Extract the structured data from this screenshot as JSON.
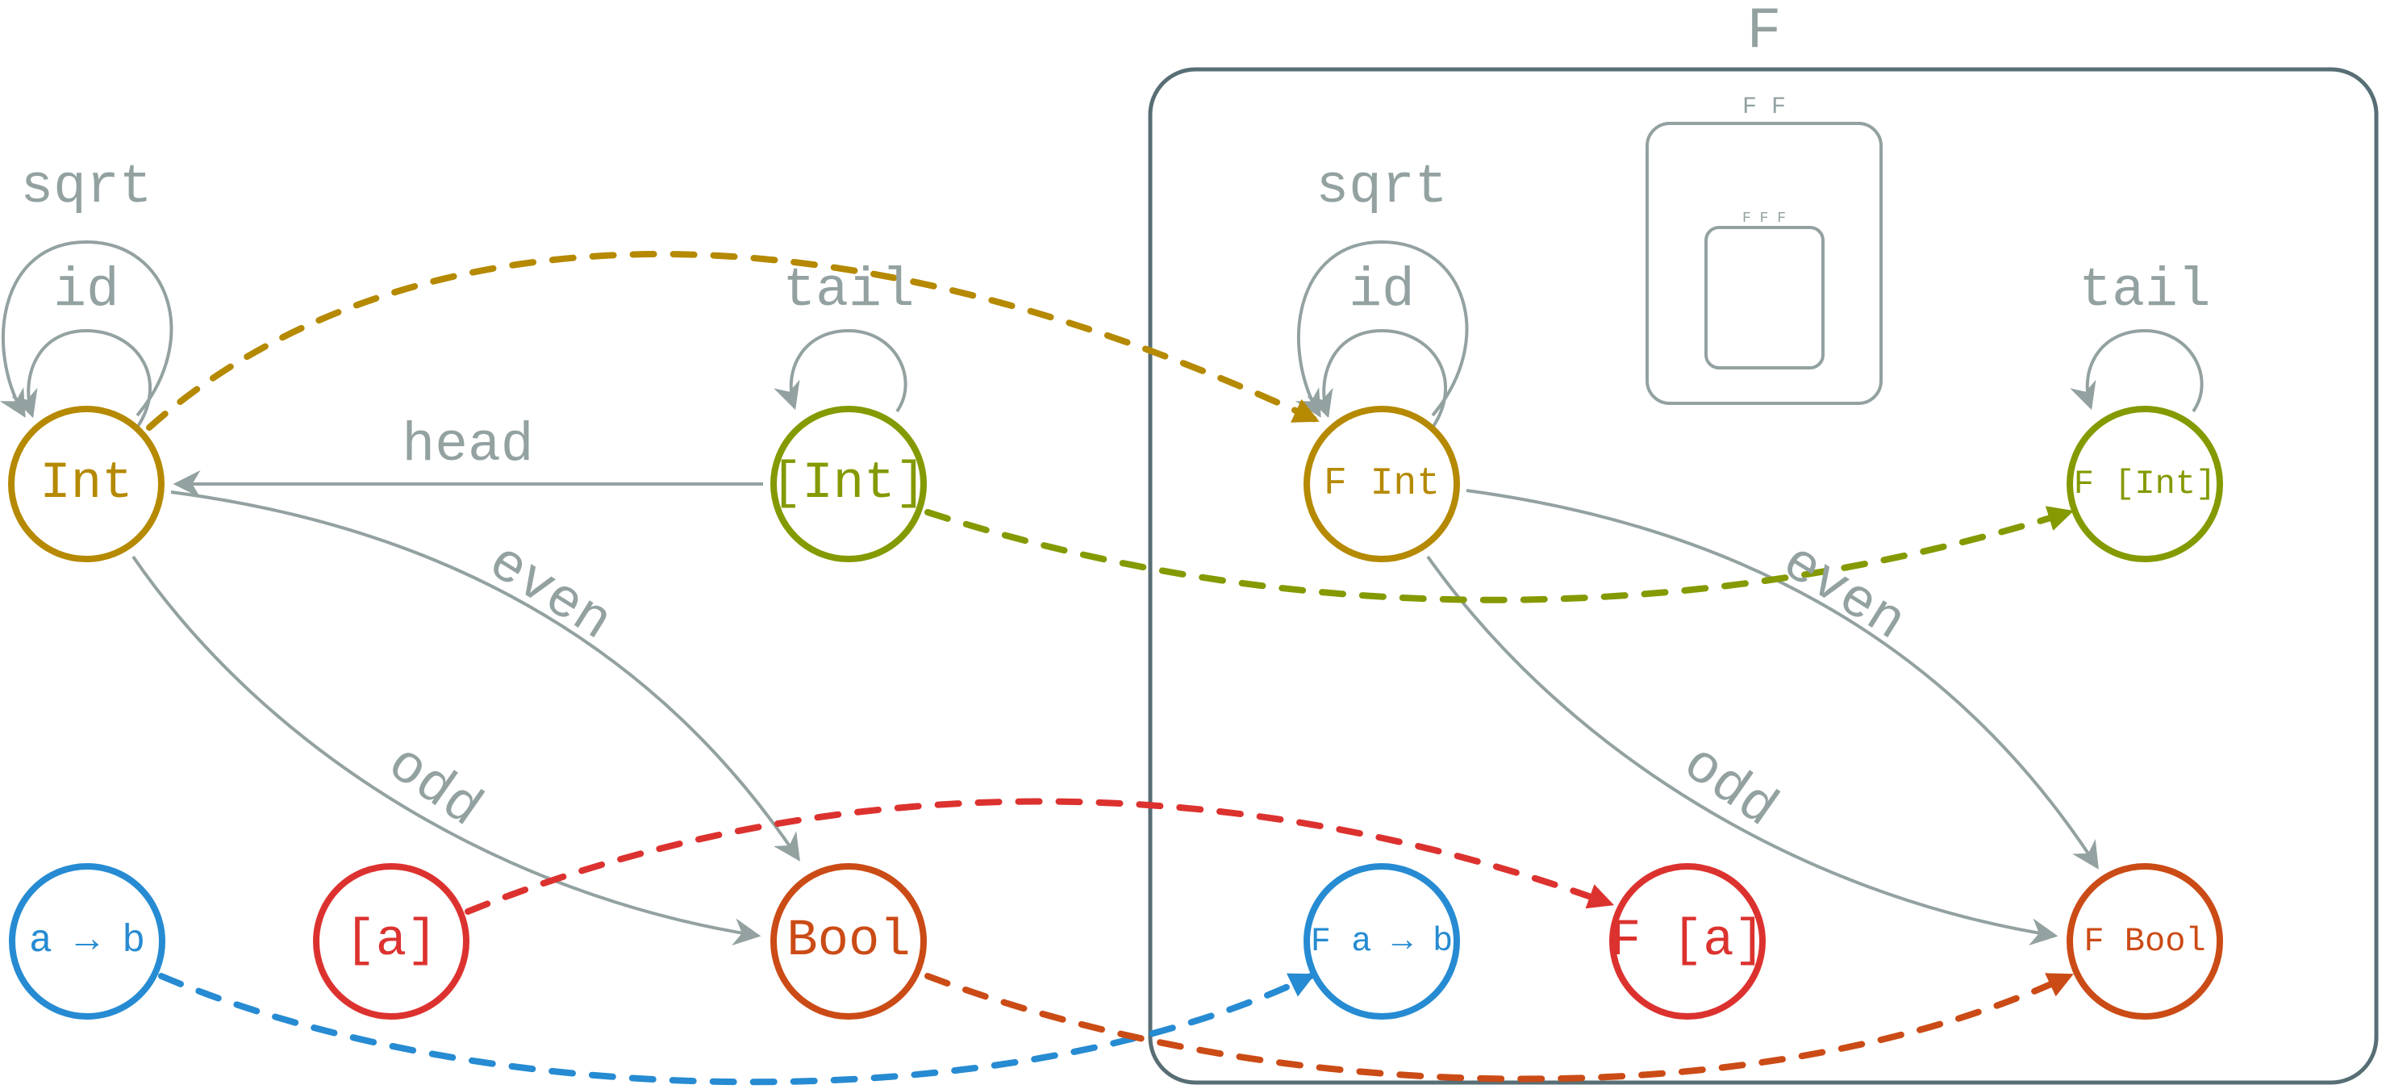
{
  "colors": {
    "int": "#b58900",
    "list_int": "#859900",
    "list_a": "#dc322f",
    "func": "#268bd2",
    "bool": "#cb4b16",
    "edge": "#93a1a1",
    "box": "#586e75"
  },
  "functor_box": {
    "label": "F"
  },
  "nested_boxes": [
    {
      "label": "F F"
    },
    {
      "label": "F F F"
    }
  ],
  "nodes": [
    {
      "id": "int",
      "label": "Int",
      "color_key": "int"
    },
    {
      "id": "list_int",
      "label": "[Int]",
      "color_key": "list_int"
    },
    {
      "id": "func",
      "label": "a → b",
      "color_key": "func"
    },
    {
      "id": "list_a",
      "label": "[a]",
      "color_key": "list_a"
    },
    {
      "id": "bool",
      "label": "Bool",
      "color_key": "bool"
    },
    {
      "id": "f_int",
      "label": "F Int",
      "color_key": "int"
    },
    {
      "id": "f_list_int",
      "label": "F [Int]",
      "color_key": "list_int"
    },
    {
      "id": "f_func",
      "label": "F a → b",
      "color_key": "func"
    },
    {
      "id": "f_list_a",
      "label": "F [a]",
      "color_key": "list_a"
    },
    {
      "id": "f_bool",
      "label": "F Bool",
      "color_key": "bool"
    }
  ],
  "edges": [
    {
      "from": "int",
      "to": "int",
      "label": "id"
    },
    {
      "from": "int",
      "to": "int",
      "label": "sqrt"
    },
    {
      "from": "list_int",
      "to": "list_int",
      "label": "tail"
    },
    {
      "from": "list_int",
      "to": "int",
      "label": "head"
    },
    {
      "from": "int",
      "to": "bool",
      "label": "even"
    },
    {
      "from": "int",
      "to": "bool",
      "label": "odd"
    },
    {
      "from": "f_int",
      "to": "f_int",
      "label": "id"
    },
    {
      "from": "f_int",
      "to": "f_int",
      "label": "sqrt"
    },
    {
      "from": "f_list_int",
      "to": "f_list_int",
      "label": "tail"
    },
    {
      "from": "f_int",
      "to": "f_bool",
      "label": "even"
    },
    {
      "from": "f_int",
      "to": "f_bool",
      "label": "odd"
    }
  ],
  "mappings": [
    {
      "from": "int",
      "to": "f_int"
    },
    {
      "from": "list_int",
      "to": "f_list_int"
    },
    {
      "from": "list_a",
      "to": "f_list_a"
    },
    {
      "from": "func",
      "to": "f_func"
    },
    {
      "from": "bool",
      "to": "f_bool"
    }
  ]
}
